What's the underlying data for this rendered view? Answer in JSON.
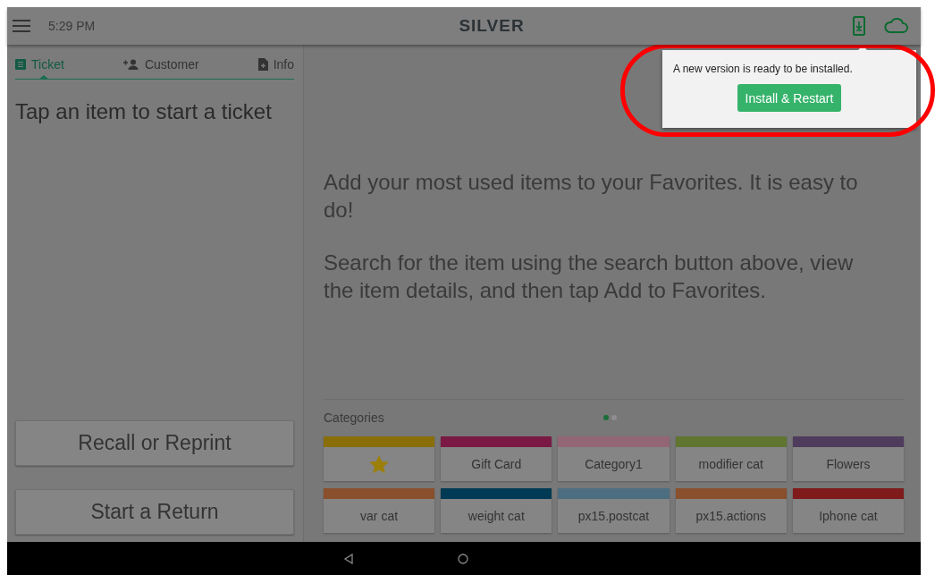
{
  "header": {
    "time": "5:29 PM",
    "logo": "SILVER"
  },
  "tabs": [
    {
      "label": "Ticket",
      "kind": "list",
      "selected": true
    },
    {
      "label": "Customer",
      "kind": "add-person",
      "selected": false
    },
    {
      "label": "Info",
      "kind": "document",
      "selected": false
    }
  ],
  "ticket": {
    "empty_message": "Tap an item to start a ticket"
  },
  "actions": [
    "Recall or Reprint",
    "Start a Return"
  ],
  "favorites_hint": [
    "Add your most used items to your Favorites. It is easy to do!",
    "Search for the item using the search button above, view the item details, and then tap Add to Favorites."
  ],
  "categories": {
    "title": "Categories",
    "pages": [
      {
        "selected": true
      },
      {
        "selected": false
      }
    ],
    "items": [
      {
        "kind": "star",
        "color": "#8a6e0a"
      },
      {
        "kind": "text",
        "label": "Gift Card",
        "color": "#7a1a44"
      },
      {
        "kind": "text",
        "label": "Category1",
        "color": "#936676"
      },
      {
        "kind": "text",
        "label": "modifier cat",
        "color": "#5f7530"
      },
      {
        "kind": "text",
        "label": "Flowers",
        "color": "#4f3c5c"
      },
      {
        "kind": "text",
        "label": "var cat",
        "color": "#8a4f2c"
      },
      {
        "kind": "text",
        "label": "weight cat",
        "color": "#003a55"
      },
      {
        "kind": "text",
        "label": "px15.postcat",
        "color": "#4d6d80"
      },
      {
        "kind": "text",
        "label": "px15.actions",
        "color": "#8a4f2c"
      },
      {
        "kind": "text",
        "label": "Iphone cat",
        "color": "#801b1b"
      }
    ]
  },
  "update_popup": {
    "message": "A new version is ready to be installed.",
    "button": "Install & Restart"
  }
}
